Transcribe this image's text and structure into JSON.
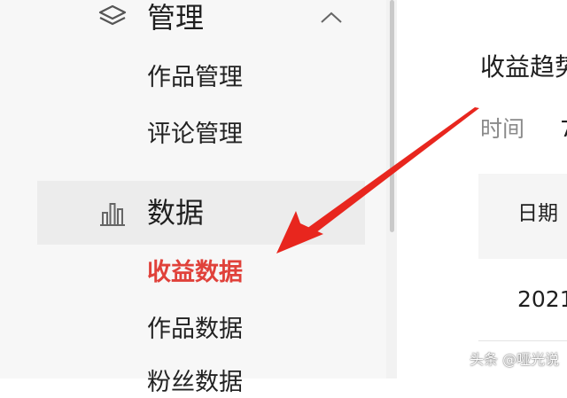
{
  "sidebar": {
    "groups": [
      {
        "label": "管理",
        "icon": "layers-icon",
        "expanded": true,
        "items": [
          {
            "label": "作品管理"
          },
          {
            "label": "评论管理"
          }
        ]
      },
      {
        "label": "数据",
        "icon": "bar-chart-icon",
        "items": [
          {
            "label": "收益数据"
          },
          {
            "label": "作品数据"
          },
          {
            "label": "粉丝数据"
          }
        ]
      }
    ]
  },
  "main": {
    "title": "收益趋势",
    "time_label": "时间",
    "time_value": "7",
    "table": {
      "date_header": "日期",
      "first_row_date": "2021"
    }
  },
  "watermark": "头条 @哑光说",
  "colors": {
    "accent_red": "#e0413a",
    "arrow_red": "#e8261e",
    "sidebar_bg": "#f7f7f7",
    "active_bg": "#ececec"
  }
}
